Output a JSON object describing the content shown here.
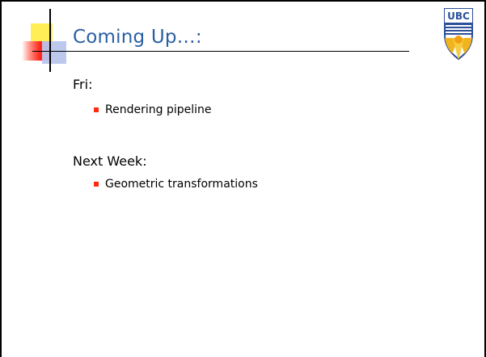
{
  "slide": {
    "title": "Coming Up…:",
    "sections": [
      {
        "heading": "Fri:",
        "bullets": [
          "Rendering pipeline"
        ]
      },
      {
        "heading": "Next Week:",
        "bullets": [
          "Geometric transformations"
        ]
      }
    ],
    "logo_text": "UBC"
  },
  "colors": {
    "title": "#2a5fa3",
    "bullet": "#ff2a10",
    "accent_yellow": "#ffee55",
    "accent_red": "#ff2a1f",
    "accent_blue": "#b8c6ec"
  }
}
